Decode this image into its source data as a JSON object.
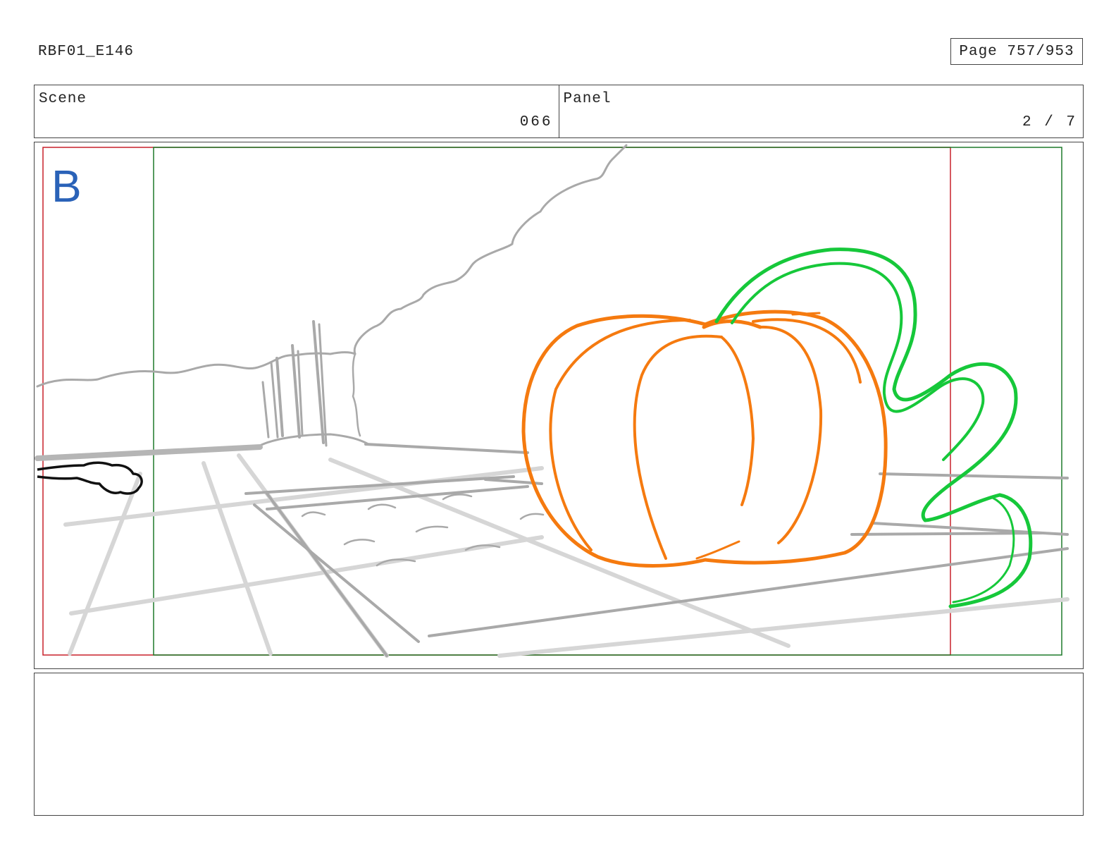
{
  "header": {
    "document_id": "RBF01_E146",
    "page_label": "Page 757/953"
  },
  "info": {
    "scene_label": "Scene",
    "scene_value": "066",
    "panel_label": "Panel",
    "panel_value": "2 / 7"
  },
  "artwork": {
    "panel_letter": "B",
    "colors": {
      "letter": "#2a62b8",
      "safe_frame": "#c8202a",
      "action_frame": "#1e7a2a",
      "pumpkin": "#f57a0f",
      "vine": "#16c83a",
      "background_lines": "#a9a9a9",
      "ink": "#111111"
    }
  },
  "notes": {
    "text": ""
  }
}
